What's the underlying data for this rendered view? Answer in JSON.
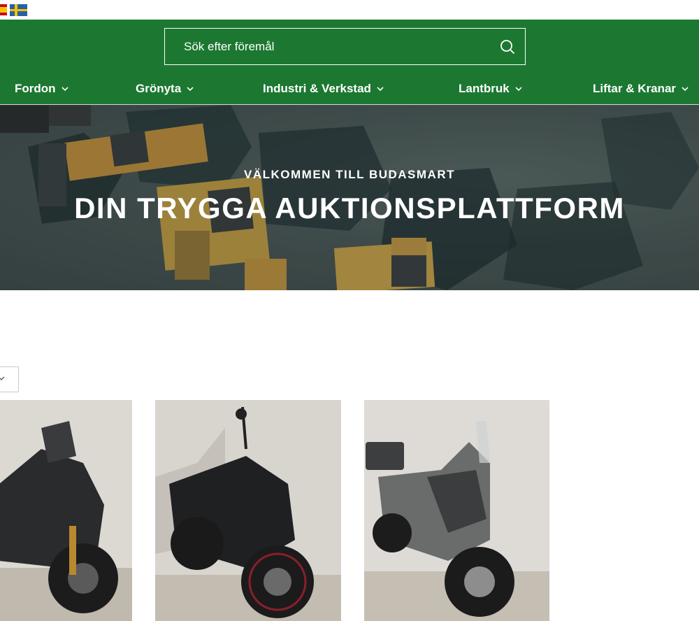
{
  "header": {
    "search": {
      "placeholder": "Sök efter föremål"
    },
    "nav": [
      {
        "label": "Fordon"
      },
      {
        "label": "Grönyta"
      },
      {
        "label": "Industri & Verkstad"
      },
      {
        "label": "Lantbruk"
      },
      {
        "label": "Liftar & Kranar"
      }
    ]
  },
  "hero": {
    "subtitle": "VÄLKOMMEN TILL BUDASMART",
    "title": "DIN TRYGGA AUKTIONSPLATTFORM"
  },
  "colors": {
    "brand_green": "#1c7831",
    "text_white": "#ffffff"
  },
  "icons": [
    "flag-spain-icon",
    "flag-sweden-icon",
    "search-icon",
    "chevron-down-icon"
  ]
}
